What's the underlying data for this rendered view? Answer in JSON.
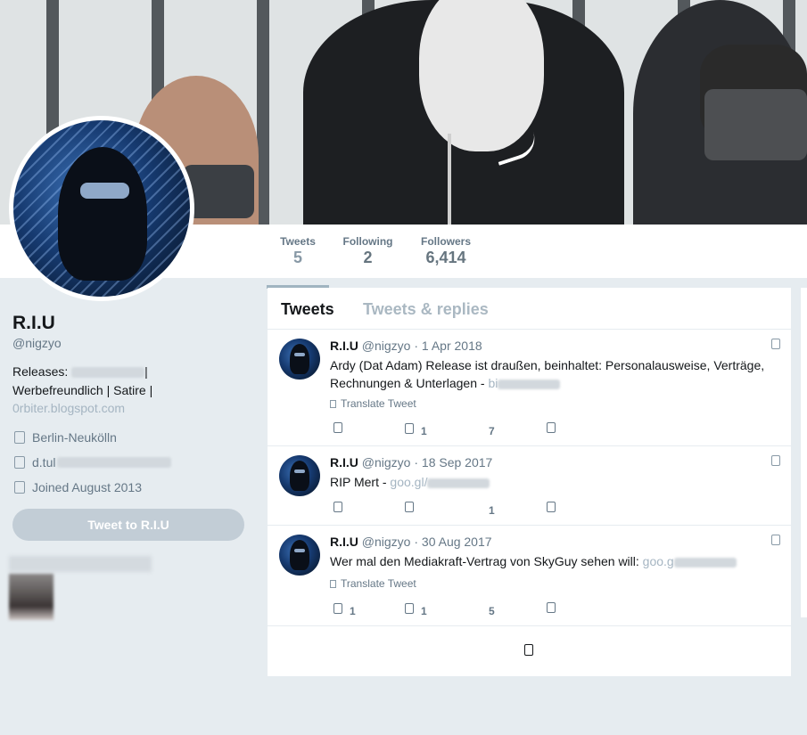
{
  "profile": {
    "name": "R.I.U",
    "handle": "@nigzyo",
    "bio_prefix": "Releases: ",
    "bio_line1_suffix": "|",
    "bio_line2": "Werbefreundlich | Satire |",
    "bio_link": "0rbiter.blogspot.com",
    "location": "Berlin-Neukölln",
    "website_prefix": "d.tul",
    "joined": "Joined August 2013",
    "tweet_to_label": "Tweet to R.I.U"
  },
  "nav": {
    "tweets_label": "Tweets",
    "tweets_count": "5",
    "following_label": "Following",
    "following_count": "2",
    "followers_label": "Followers",
    "followers_count": "6,414"
  },
  "timeline": {
    "tabs": [
      "Tweets",
      "Tweets & replies"
    ],
    "translate_label": "Translate Tweet",
    "tweets": [
      {
        "name": "R.I.U",
        "handle": "@nigzyo",
        "date": "· 1 Apr 2018",
        "text": "Ardy (Dat Adam) Release ist draußen, beinhaltet: Personalausweise, Verträge, Rechnungen & Unterlagen - ",
        "link": "bi",
        "replies": "",
        "retweets": "1",
        "likes": "7"
      },
      {
        "name": "R.I.U",
        "handle": "@nigzyo",
        "date": "· 18 Sep 2017",
        "text": "RIP Mert - ",
        "link": "goo.gl/",
        "replies": "",
        "retweets": "",
        "likes": "1"
      },
      {
        "name": "R.I.U",
        "handle": "@nigzyo",
        "date": "· 30 Aug 2017",
        "text": "Wer mal den Mediakraft-Vertrag von SkyGuy sehen will: ",
        "link": "goo.g",
        "replies": "1",
        "retweets": "1",
        "likes": "5"
      }
    ]
  },
  "icons": {
    "location": "map-pin-icon",
    "website": "link-icon",
    "joined": "calendar-icon",
    "reply": "reply-icon",
    "retweet": "retweet-icon",
    "like": "heart-icon",
    "message": "envelope-icon",
    "caret": "chevron-down-icon",
    "globe": "globe-icon",
    "loading": "loading-icon"
  },
  "colors": {
    "background": "#e6ecf0",
    "muted": "#657786",
    "link_muted": "#a5b5c2",
    "button": "#c2cdd6"
  }
}
